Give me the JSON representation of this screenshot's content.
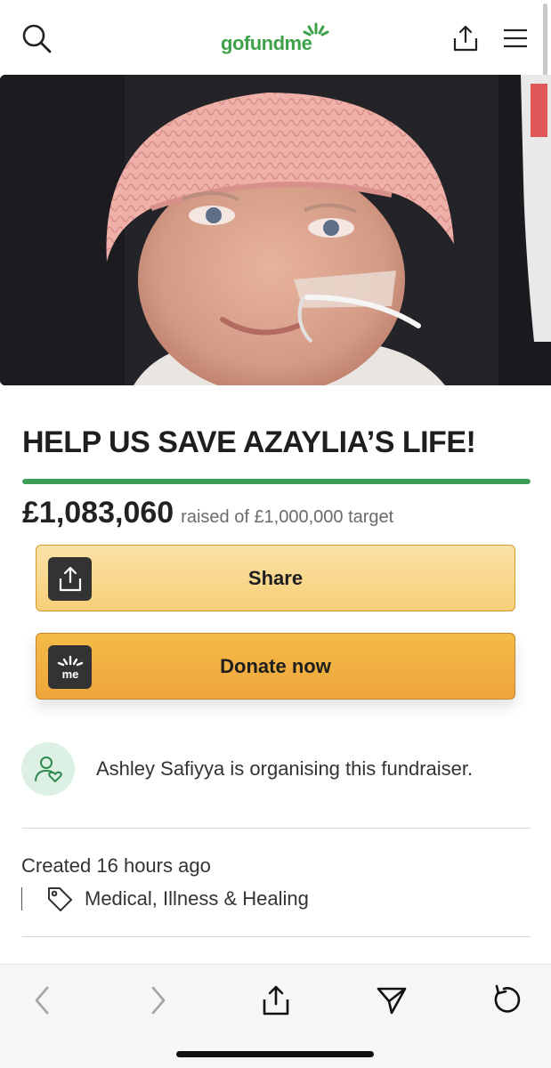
{
  "header": {
    "logo_text": "gofundme",
    "icons": [
      "search-icon",
      "share-icon",
      "menu-icon"
    ]
  },
  "campaign": {
    "title": "HELP US SAVE AZAYLIA’S LIFE!",
    "raised_amount": "£1,083,060",
    "raised_text": "raised of £1,000,000 target",
    "progress_fraction": 1.0,
    "accent_color": "#3c9e57"
  },
  "buttons": {
    "share_label": "Share",
    "donate_label": "Donate now",
    "donate_icon_text": "me"
  },
  "organiser": {
    "text": "Ashley Safiyya is organising this fundraiser."
  },
  "meta": {
    "created": "Created 16 hours ago",
    "category": "Medical, Illness & Healing"
  },
  "browser_bar": {
    "icons": [
      "back-icon",
      "forward-icon",
      "share-icon",
      "send-icon",
      "reload-icon"
    ]
  }
}
